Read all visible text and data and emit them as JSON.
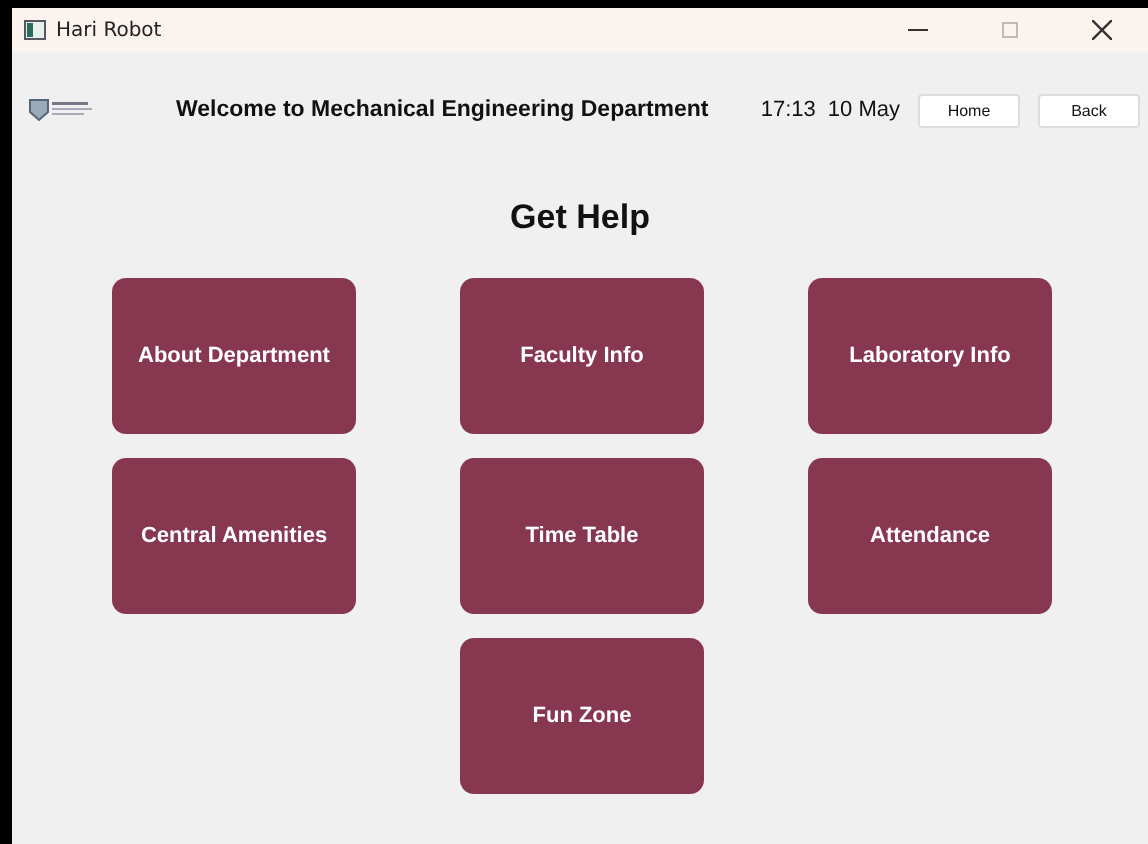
{
  "window": {
    "title": "Hari Robot"
  },
  "header": {
    "title": "Welcome to Mechanical Engineering Department",
    "time": "17:13",
    "date": "10 May",
    "buttons": [
      "Home",
      "Back"
    ]
  },
  "heading": "Get Help",
  "menu": [
    {
      "label": "About Department"
    },
    {
      "label": "Faculty Info"
    },
    {
      "label": "Laboratory Info"
    },
    {
      "label": "Central Amenities"
    },
    {
      "label": "Time Table"
    },
    {
      "label": "Attendance"
    },
    {
      "label": "Fun Zone"
    }
  ]
}
